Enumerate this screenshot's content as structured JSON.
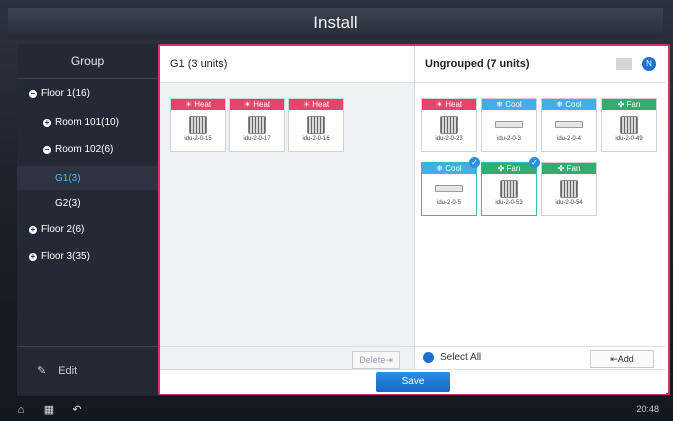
{
  "header": {
    "title": "Install"
  },
  "sidebar": {
    "heading": "Group",
    "items": [
      {
        "label": "Floor 1(16)"
      },
      {
        "label": "Room 101(10)"
      },
      {
        "label": "Room 102(6)"
      },
      {
        "label": "G1(3)"
      },
      {
        "label": "G2(3)"
      },
      {
        "label": "Floor 2(6)"
      },
      {
        "label": "Floor 3(35)"
      }
    ],
    "edit_label": "Edit"
  },
  "left_panel": {
    "title": "G1 (3 units)",
    "cards": [
      {
        "mode": "Heat",
        "name": "idu-2-0-15"
      },
      {
        "mode": "Heat",
        "name": "idu-2-0-17"
      },
      {
        "mode": "Heat",
        "name": "idu-2-0-16"
      }
    ],
    "delete_label": "Delete"
  },
  "right_panel": {
    "title": "Ungrouped (7 units)",
    "n_badge": "N",
    "cards": [
      {
        "mode": "Heat",
        "name": "idu-2-0-23"
      },
      {
        "mode": "Cool",
        "name": "idu-2-0-3"
      },
      {
        "mode": "Cool",
        "name": "idu-2-0-4"
      },
      {
        "mode": "Fan",
        "name": "idu-2-0-49"
      },
      {
        "mode": "Cool",
        "name": "idu-2-0-5"
      },
      {
        "mode": "Fan",
        "name": "idu-2-0-53"
      },
      {
        "mode": "Fan",
        "name": "idu-2-0-54"
      }
    ],
    "select_all_label": "Select All",
    "add_label": "Add"
  },
  "save_label": "Save",
  "taskbar": {
    "time": "20:48"
  }
}
